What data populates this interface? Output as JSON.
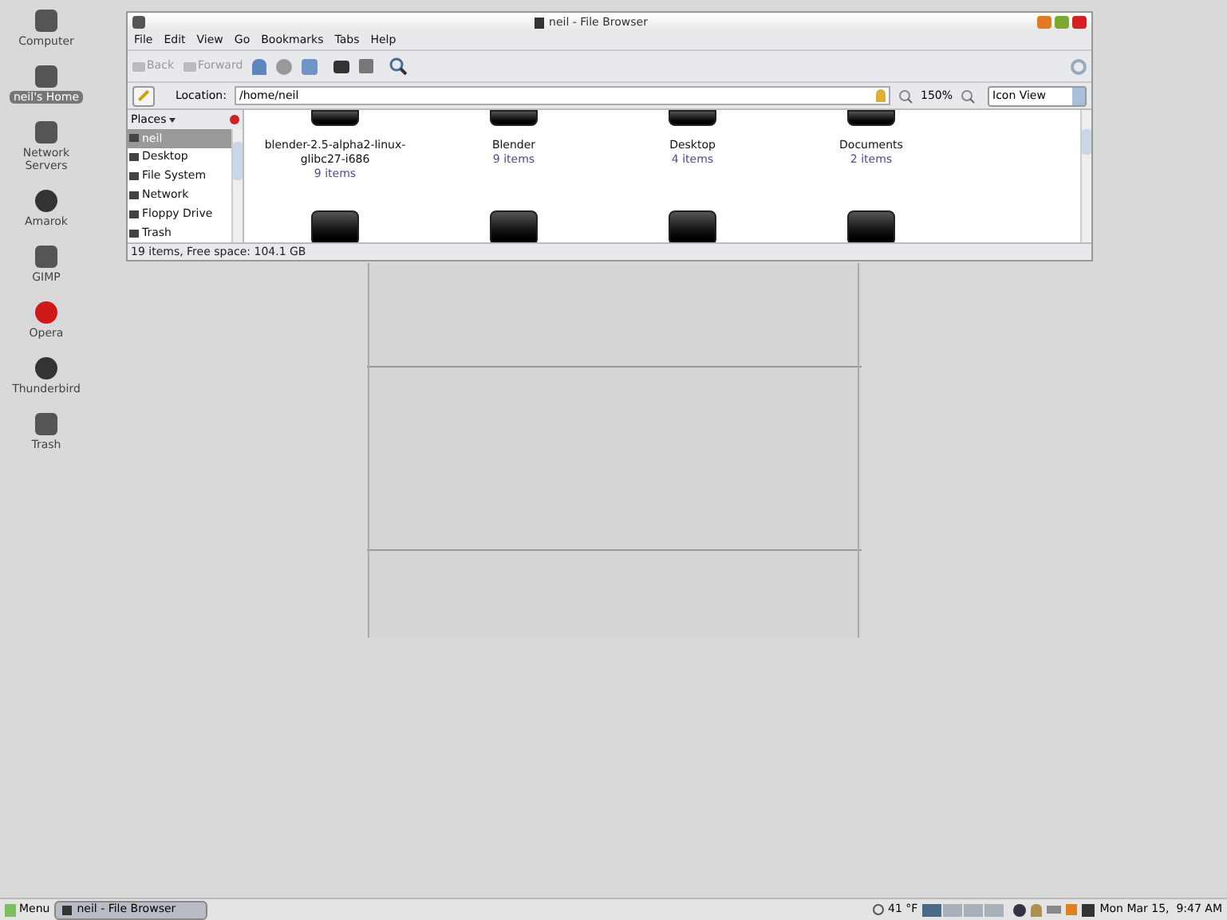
{
  "desktop_icons": [
    {
      "label": "Computer",
      "selected": false
    },
    {
      "label": "neil's Home",
      "selected": true
    },
    {
      "label": "Network Servers",
      "selected": false
    },
    {
      "label": "Amarok",
      "selected": false
    },
    {
      "label": "GIMP",
      "selected": false
    },
    {
      "label": "Opera",
      "selected": false
    },
    {
      "label": "Thunderbird",
      "selected": false
    },
    {
      "label": "Trash",
      "selected": false
    }
  ],
  "window": {
    "title": "neil - File Browser",
    "menu": [
      "File",
      "Edit",
      "View",
      "Go",
      "Bookmarks",
      "Tabs",
      "Help"
    ],
    "toolbar": [
      {
        "label": "Back",
        "disabled": true
      },
      {
        "label": "Forward",
        "disabled": true
      }
    ],
    "location": {
      "label": "Location:",
      "value": "/home/neil"
    },
    "zoom": "150%",
    "view_select": "Icon View",
    "places": {
      "title": "Places",
      "items": [
        {
          "label": "neil",
          "selected": true
        },
        {
          "label": "Desktop",
          "selected": false
        },
        {
          "label": "File System",
          "selected": false
        },
        {
          "label": "Network",
          "selected": false
        },
        {
          "label": "Floppy Drive",
          "selected": false
        },
        {
          "label": "Trash",
          "selected": false
        }
      ]
    },
    "files": [
      {
        "name": "blender-2.5-alpha2-linux-glibc27-i686",
        "count": "9 items"
      },
      {
        "name": "Blender",
        "count": "9 items"
      },
      {
        "name": "Desktop",
        "count": "4 items"
      },
      {
        "name": "Documents",
        "count": "2 items"
      }
    ],
    "status_bar": "19 items, Free space: 104.1 GB"
  },
  "taskbar": {
    "menu": "Menu",
    "tasks": [
      {
        "label": "neil - File Browser",
        "selected": true
      }
    ],
    "weather": "41 °F",
    "workspaces": [
      {
        "selected": true
      },
      {
        "selected": false
      },
      {
        "selected": false
      },
      {
        "selected": false
      }
    ],
    "clock": "Mon Mar 15,  9:47 AM"
  }
}
